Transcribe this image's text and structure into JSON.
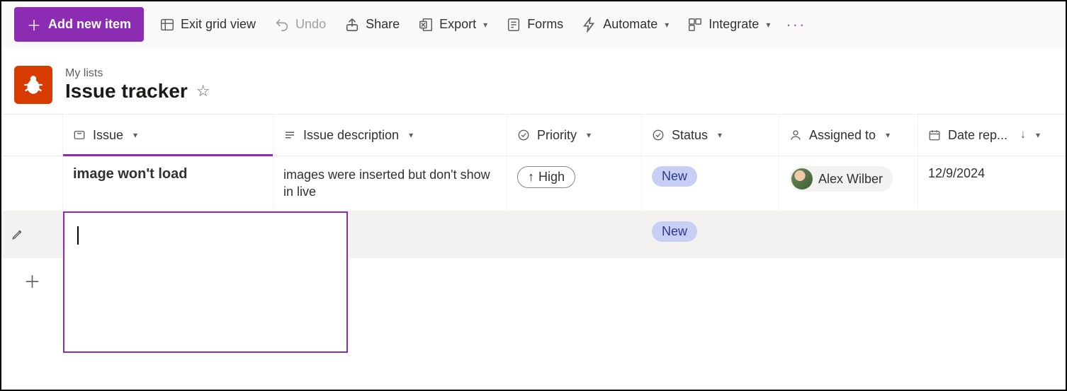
{
  "toolbar": {
    "add_label": "Add new item",
    "exit_grid_label": "Exit grid view",
    "undo_label": "Undo",
    "share_label": "Share",
    "export_label": "Export",
    "forms_label": "Forms",
    "automate_label": "Automate",
    "integrate_label": "Integrate"
  },
  "header": {
    "breadcrumb": "My lists",
    "title": "Issue tracker"
  },
  "columns": {
    "issue": "Issue",
    "description": "Issue description",
    "priority": "Priority",
    "status": "Status",
    "assigned_to": "Assigned to",
    "date_reported": "Date rep..."
  },
  "rows": [
    {
      "issue": "image won't load",
      "description": "images were inserted but don't show in live",
      "priority": "High",
      "status": "New",
      "assigned_to": "Alex Wilber",
      "date_reported": "12/9/2024"
    },
    {
      "issue": "",
      "description": "",
      "priority": "",
      "status": "New",
      "assigned_to": "",
      "date_reported": ""
    }
  ]
}
